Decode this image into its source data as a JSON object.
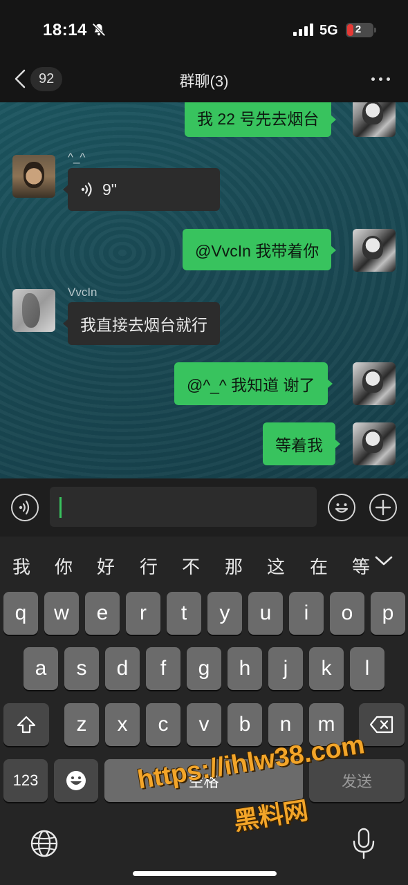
{
  "status_bar": {
    "time": "18:14",
    "network": "5G",
    "battery": "2"
  },
  "nav": {
    "back_count": "92",
    "title": "群聊(3)"
  },
  "messages": [
    {
      "from": "me",
      "text": "我 22 号先去烟台"
    },
    {
      "from": "other",
      "sender": "^_^",
      "type": "voice",
      "text": "9\""
    },
    {
      "from": "me",
      "text": "@VvcIn 我带着你"
    },
    {
      "from": "other",
      "sender": "VvcIn",
      "text": "我直接去烟台就行"
    },
    {
      "from": "me",
      "text": "@^_^ 我知道 谢了"
    },
    {
      "from": "me",
      "text": "等着我"
    }
  ],
  "input": {
    "value": ""
  },
  "keyboard": {
    "candidates": [
      "我",
      "你",
      "好",
      "行",
      "不",
      "那",
      "这",
      "在",
      "等"
    ],
    "row1": [
      "q",
      "w",
      "e",
      "r",
      "t",
      "y",
      "u",
      "i",
      "o",
      "p"
    ],
    "row2": [
      "a",
      "s",
      "d",
      "f",
      "g",
      "h",
      "j",
      "k",
      "l"
    ],
    "row3": [
      "z",
      "x",
      "c",
      "v",
      "b",
      "n",
      "m"
    ],
    "numbers_label": "123",
    "space_label": "空格",
    "send_label": "发送"
  },
  "watermark": {
    "url": "https://ihlw38.com",
    "name": "黑料网"
  },
  "colors": {
    "accent_green": "#38c35e",
    "chat_bg": "#1a4a55",
    "bubble_dark": "#2c2c2c"
  }
}
